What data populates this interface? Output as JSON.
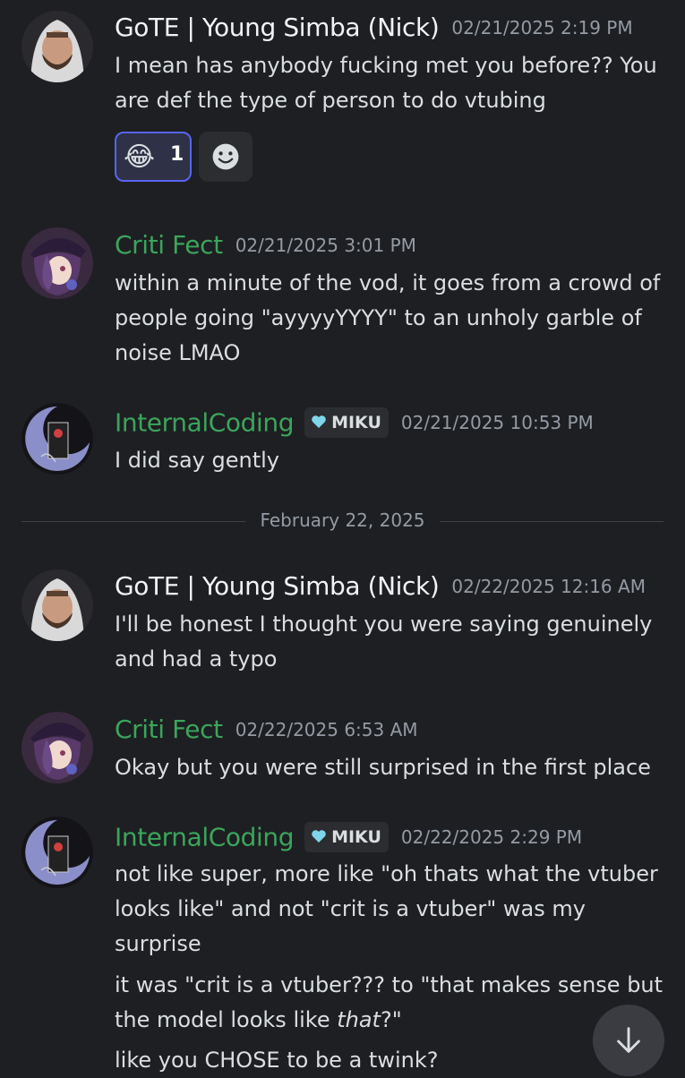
{
  "colors": {
    "background": "#1e1f22",
    "text": "#dbdee1",
    "timestamp": "#949ba4",
    "name_gote": "#f2f3f5",
    "name_criti": "#3ba55c",
    "name_internal": "#3ba55c",
    "reaction_active_border": "#5865f2"
  },
  "messages": [
    {
      "author": "GoTE | Young Simba (Nick)",
      "timestamp": "02/21/2025 2:19 PM",
      "lines": [
        "I mean has anybody fucking met you before?? You",
        "are def the type of person to do vtubing"
      ],
      "reactions": [
        {
          "emoji": "😂",
          "emoji_name": "joy-emoji",
          "count": "1"
        }
      ],
      "add_reaction_icon": "smiley-icon"
    },
    {
      "author": "Criti Fect",
      "timestamp": "02/21/2025 3:01 PM",
      "lines": [
        "within a minute of the vod, it goes from a crowd of",
        "people going \"ayyyyYYYY\" to an unholy garble of",
        "noise LMAO"
      ]
    },
    {
      "author": "InternalCoding",
      "badge": "MIKU",
      "badge_icon": "heart-icon",
      "timestamp": "02/21/2025 10:53 PM",
      "lines": [
        "I did say gently"
      ]
    },
    {
      "author": "GoTE | Young Simba (Nick)",
      "timestamp": "02/22/2025 12:16 AM",
      "lines": [
        "I'll be honest I thought you were saying genuinely",
        "and had a typo"
      ]
    },
    {
      "author": "Criti Fect",
      "timestamp": "02/22/2025 6:53 AM",
      "lines": [
        "Okay but you were still surprised in the first place"
      ]
    },
    {
      "author": "InternalCoding",
      "badge": "MIKU",
      "badge_icon": "heart-icon",
      "timestamp": "02/22/2025 2:29 PM",
      "lines": [
        "not like super, more like \"oh thats what the vtuber",
        "looks like\" and not \"crit is a vtuber\" was my",
        "surprise"
      ],
      "followups": [
        {
          "prefix": "it was \"crit is a vtuber??? to \"that makes sense but",
          "line2_pre": "the model looks like ",
          "line2_em": "that",
          "line2_post": "?\""
        },
        {
          "text": "like you CHOSE to be a twink?"
        }
      ]
    }
  ],
  "date_divider": "February 22, 2025",
  "scroll_icon": "arrow-down-icon"
}
